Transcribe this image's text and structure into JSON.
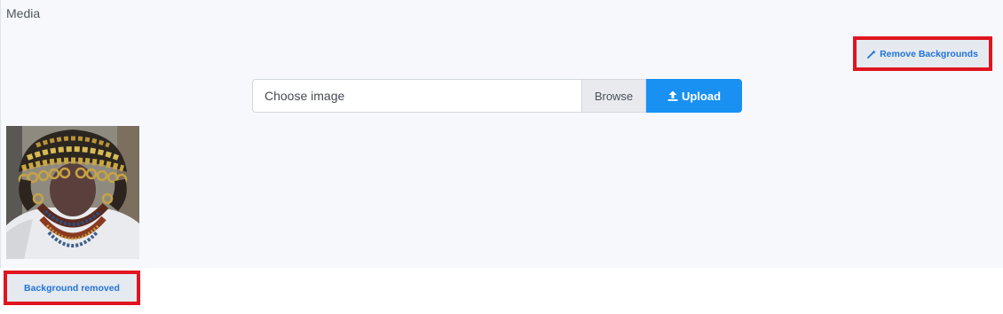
{
  "media": {
    "title": "Media",
    "remove_backgrounds_label": "Remove Backgrounds",
    "file_input": {
      "placeholder": "Choose image",
      "browse_label": "Browse"
    },
    "upload_label": "Upload",
    "items": [
      {
        "thumbnail_alt": "Figure wearing gold headdress and beaded necklaces",
        "status_label": "Background removed"
      }
    ]
  },
  "colors": {
    "primary": "#1891f2",
    "link": "#2273d8",
    "highlight": "#e0151f",
    "panel_bg": "#f6f8fc"
  },
  "icons": {
    "remove_backgrounds": "magic-wand-icon",
    "upload": "upload-icon"
  }
}
